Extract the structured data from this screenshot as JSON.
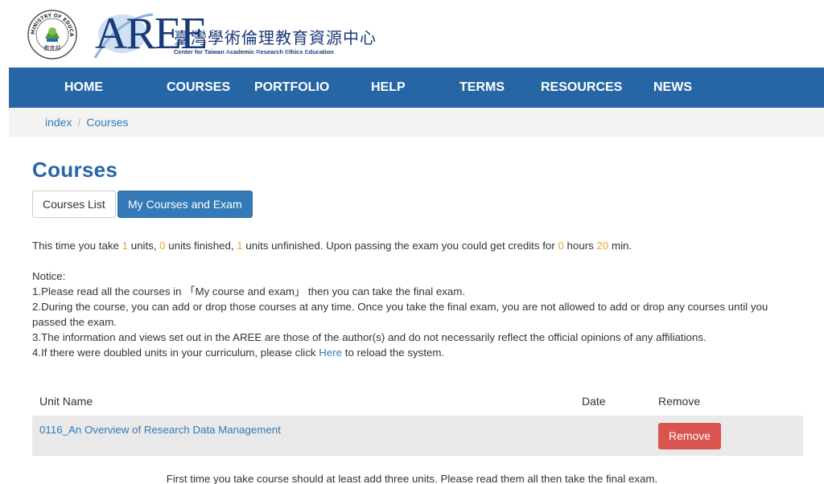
{
  "logo": {
    "org_zh": "臺灣學術倫理教育資源中心",
    "org_en_parts": [
      "Center for Taiwan ",
      "A",
      "cademic ",
      "R",
      "esearch ",
      "E",
      "thics ",
      "E",
      "ducation"
    ],
    "brand": "AREE",
    "seal_top_text": "MINISTRY OF EDUCATION",
    "seal_bottom_text": "教育部"
  },
  "nav": {
    "items": [
      "HOME",
      "COURSES",
      "PORTFOLIO",
      "HELP",
      "TERMS",
      "RESOURCES",
      "NEWS"
    ]
  },
  "breadcrumb": {
    "items": [
      "index",
      "Courses"
    ],
    "separator": "/"
  },
  "page": {
    "title": "Courses",
    "tabs": [
      "Courses List",
      "My Courses and Exam"
    ]
  },
  "summary": {
    "p1": "This time you take ",
    "units_taken": "1",
    "p2": " units, ",
    "units_finished": "0",
    "p3": " units finished, ",
    "units_unfinished": "1",
    "p4": " units unfinished. Upon passing the exam you could get credits for ",
    "hours": "0",
    "p5": " hours ",
    "minutes": "20",
    "p6": " min."
  },
  "notice": {
    "heading": "Notice:",
    "line1": "1.Please read all the courses in 「My course and exam」 then you can take the final exam.",
    "line2": "2.During the course, you can add or drop those courses at any time. Once you take the final exam, you are not allowed to add or drop any courses until you passed the exam.",
    "line3": "3.The information and views set out in the AREE are those of the author(s) and do not necessarily reflect the official opinions of any affiliations.",
    "line4_pre": "4.If there were doubled units in your curriculum, please click ",
    "line4_link": "Here",
    "line4_post": " to reload the system."
  },
  "table": {
    "headers": {
      "unit_name": "Unit Name",
      "date": "Date",
      "remove": "Remove"
    },
    "rows": [
      {
        "unit_name": "0116_An Overview of Research Data Management",
        "date": "",
        "remove_label": "Remove"
      }
    ]
  },
  "footnote": "First time you take course should at least add three units. Please read them all then take the final exam.",
  "colors": {
    "nav_bg": "#2766a5",
    "primary": "#337ab7",
    "danger": "#d9534f",
    "highlight": "#f0a038",
    "breadcrumb_bg": "#f3f3f3",
    "row_bg": "#e9e9e9"
  }
}
